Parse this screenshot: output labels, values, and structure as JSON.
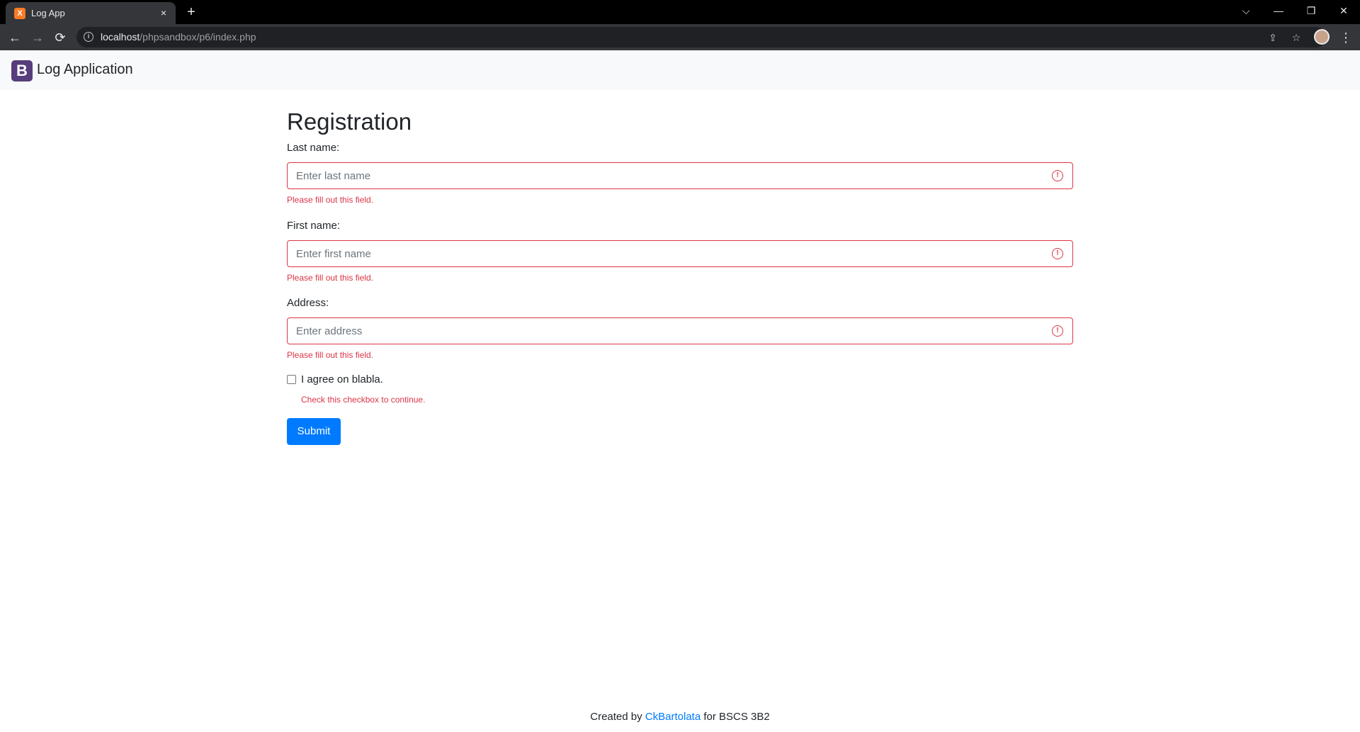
{
  "browser": {
    "tab_title": "Log App",
    "tab_favicon": "xampp-icon",
    "tab_close": "×",
    "new_tab": "+",
    "url_host": "localhost",
    "url_path": "/phpsandbox/p6/index.php",
    "window_controls": {
      "tab_search": "⌵",
      "minimize": "—",
      "restore": "❐",
      "close": "✕"
    },
    "nav": {
      "back": "←",
      "forward": "→",
      "reload": "⟳"
    },
    "info": "i",
    "share": "⇪",
    "bookmark": "☆",
    "menu": "⋮"
  },
  "navbar": {
    "brand_logo": "B",
    "brand_text": "Log Application"
  },
  "form": {
    "title": "Registration",
    "fields": [
      {
        "label": "Last name:",
        "placeholder": "Enter last name",
        "error": "Please fill out this field."
      },
      {
        "label": "First name:",
        "placeholder": "Enter first name",
        "error": "Please fill out this field."
      },
      {
        "label": "Address:",
        "placeholder": "Enter address",
        "error": "Please fill out this field."
      }
    ],
    "invalid_icon": "!",
    "checkbox": {
      "label": "I agree on blabla.",
      "error": "Check this checkbox to continue.",
      "checked": false
    },
    "submit_label": "Submit"
  },
  "footer": {
    "prefix": "Created by",
    "author": "CkBartolata",
    "suffix": "for BSCS 3B2"
  },
  "colors": {
    "primary": "#007bff",
    "danger": "#dc3545",
    "brand": "#563d7c",
    "navbar_bg": "#f8f9fa"
  }
}
